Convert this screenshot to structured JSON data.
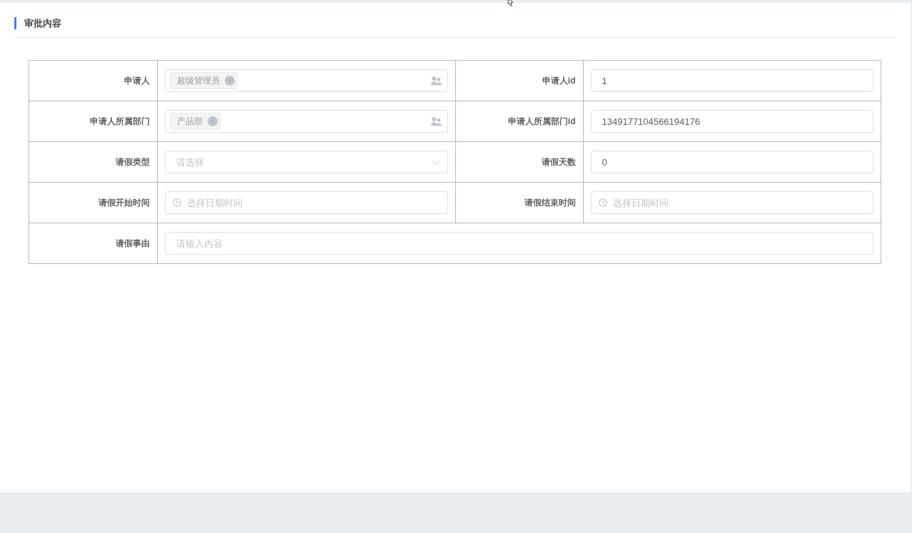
{
  "section": {
    "title": "审批内容"
  },
  "form": {
    "rows": [
      {
        "fields": [
          {
            "label": "申请人",
            "kind": "tags",
            "tags": [
              "超级管理员"
            ]
          },
          {
            "label": "申请人id",
            "kind": "text",
            "value": "1"
          }
        ]
      },
      {
        "fields": [
          {
            "label": "申请人所属部门",
            "kind": "tags",
            "tags": [
              "产品部"
            ]
          },
          {
            "label": "申请人所属部门id",
            "kind": "text",
            "value": "1349177104566194176"
          }
        ]
      },
      {
        "fields": [
          {
            "label": "请假类型",
            "kind": "select",
            "placeholder": "请选择"
          },
          {
            "label": "请假天数",
            "kind": "text",
            "value": "0"
          }
        ]
      },
      {
        "fields": [
          {
            "label": "请假开始时间",
            "kind": "datetime",
            "placeholder": "选择日期时间"
          },
          {
            "label": "请假结束时间",
            "kind": "datetime",
            "placeholder": "选择日期时间"
          }
        ]
      },
      {
        "fields": [
          {
            "label": "请假事由",
            "kind": "text",
            "placeholder": "请输入内容"
          }
        ]
      }
    ]
  }
}
